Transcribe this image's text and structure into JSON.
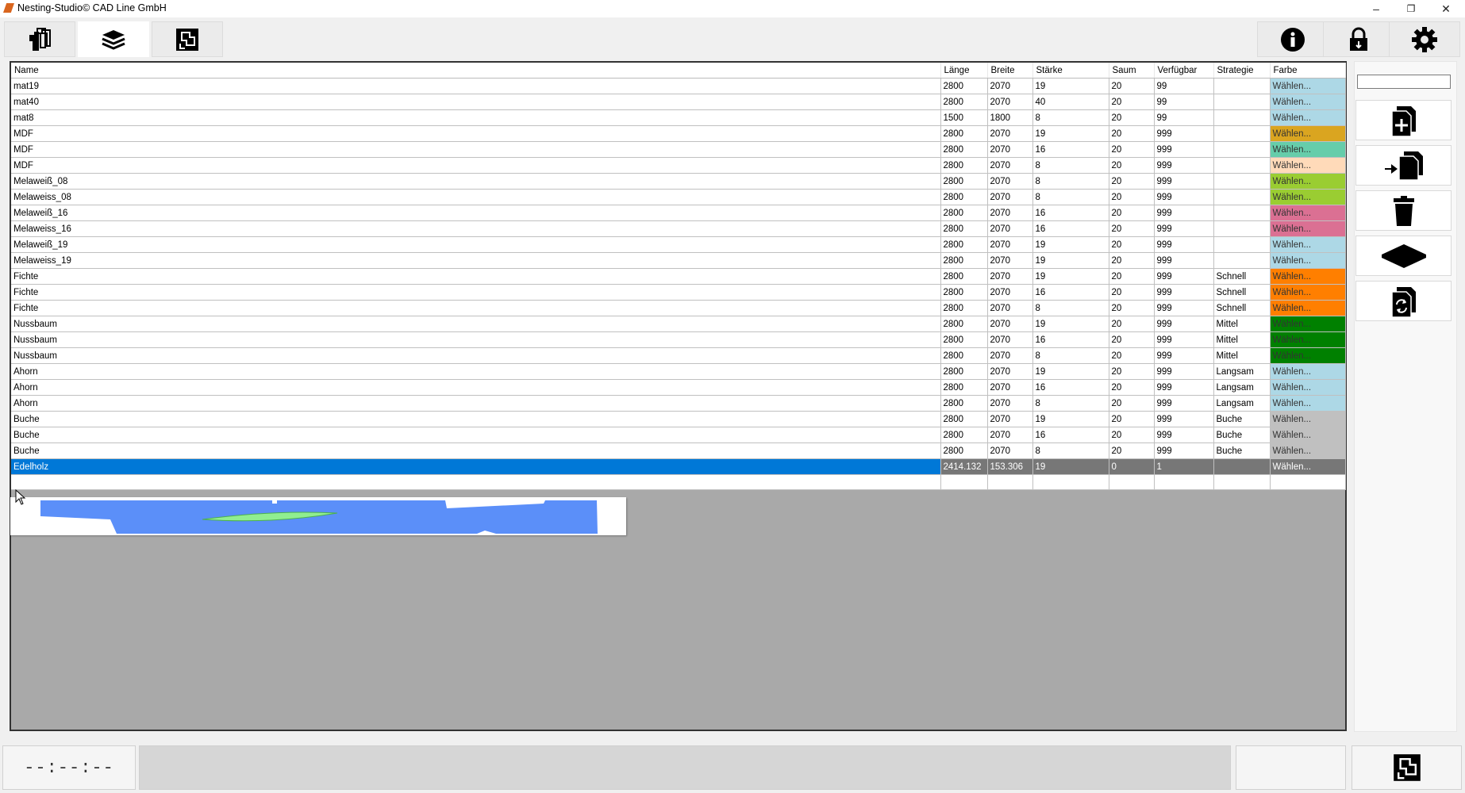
{
  "window": {
    "title": "Nesting-Studio© CAD Line GmbH",
    "minimize": "–",
    "restore": "❐",
    "close": "✕"
  },
  "toolbar": {
    "left_icons": [
      "parts-icon",
      "layers-icon",
      "nesting-icon"
    ],
    "active_tab": "layers-icon",
    "right_icons": [
      "info-icon",
      "lock-icon",
      "gear-icon"
    ]
  },
  "table": {
    "columns": [
      "Name",
      "Länge",
      "Breite",
      "Stärke",
      "Saum",
      "Verfügbar",
      "Strategie",
      "Farbe"
    ],
    "rows": [
      {
        "name": "mat19",
        "laenge": "2800",
        "breite": "2070",
        "staerke": "19",
        "saum": "20",
        "verfuegbar": "99",
        "strategie": "",
        "farbe": "Wählen...",
        "color": "#add8e6"
      },
      {
        "name": "mat40",
        "laenge": "2800",
        "breite": "2070",
        "staerke": "40",
        "saum": "20",
        "verfuegbar": "99",
        "strategie": "",
        "farbe": "Wählen...",
        "color": "#add8e6"
      },
      {
        "name": "mat8",
        "laenge": "1500",
        "breite": "1800",
        "staerke": "8",
        "saum": "20",
        "verfuegbar": "99",
        "strategie": "",
        "farbe": "Wählen...",
        "color": "#add8e6"
      },
      {
        "name": "MDF",
        "laenge": "2800",
        "breite": "2070",
        "staerke": "19",
        "saum": "20",
        "verfuegbar": "999",
        "strategie": "",
        "farbe": "Wählen...",
        "color": "#daa520"
      },
      {
        "name": "MDF",
        "laenge": "2800",
        "breite": "2070",
        "staerke": "16",
        "saum": "20",
        "verfuegbar": "999",
        "strategie": "",
        "farbe": "Wählen...",
        "color": "#66cdaa"
      },
      {
        "name": "MDF",
        "laenge": "2800",
        "breite": "2070",
        "staerke": "8",
        "saum": "20",
        "verfuegbar": "999",
        "strategie": "",
        "farbe": "Wählen...",
        "color": "#ffdab9"
      },
      {
        "name": "Melaweiß_08",
        "laenge": "2800",
        "breite": "2070",
        "staerke": "8",
        "saum": "20",
        "verfuegbar": "999",
        "strategie": "",
        "farbe": "Wählen...",
        "color": "#9acd32"
      },
      {
        "name": "Melaweiss_08",
        "laenge": "2800",
        "breite": "2070",
        "staerke": "8",
        "saum": "20",
        "verfuegbar": "999",
        "strategie": "",
        "farbe": "Wählen...",
        "color": "#9acd32"
      },
      {
        "name": "Melaweiß_16",
        "laenge": "2800",
        "breite": "2070",
        "staerke": "16",
        "saum": "20",
        "verfuegbar": "999",
        "strategie": "",
        "farbe": "Wählen...",
        "color": "#db7093"
      },
      {
        "name": "Melaweiss_16",
        "laenge": "2800",
        "breite": "2070",
        "staerke": "16",
        "saum": "20",
        "verfuegbar": "999",
        "strategie": "",
        "farbe": "Wählen...",
        "color": "#db7093"
      },
      {
        "name": "Melaweiß_19",
        "laenge": "2800",
        "breite": "2070",
        "staerke": "19",
        "saum": "20",
        "verfuegbar": "999",
        "strategie": "",
        "farbe": "Wählen...",
        "color": "#add8e6"
      },
      {
        "name": "Melaweiss_19",
        "laenge": "2800",
        "breite": "2070",
        "staerke": "19",
        "saum": "20",
        "verfuegbar": "999",
        "strategie": "",
        "farbe": "Wählen...",
        "color": "#add8e6"
      },
      {
        "name": "Fichte",
        "laenge": "2800",
        "breite": "2070",
        "staerke": "19",
        "saum": "20",
        "verfuegbar": "999",
        "strategie": "Schnell",
        "farbe": "Wählen...",
        "color": "#ff7f00"
      },
      {
        "name": "Fichte",
        "laenge": "2800",
        "breite": "2070",
        "staerke": "16",
        "saum": "20",
        "verfuegbar": "999",
        "strategie": "Schnell",
        "farbe": "Wählen...",
        "color": "#ff7f00"
      },
      {
        "name": "Fichte",
        "laenge": "2800",
        "breite": "2070",
        "staerke": "8",
        "saum": "20",
        "verfuegbar": "999",
        "strategie": "Schnell",
        "farbe": "Wählen...",
        "color": "#ff7f00"
      },
      {
        "name": "Nussbaum",
        "laenge": "2800",
        "breite": "2070",
        "staerke": "19",
        "saum": "20",
        "verfuegbar": "999",
        "strategie": "Mittel",
        "farbe": "Wählen...",
        "color": "#008000"
      },
      {
        "name": "Nussbaum",
        "laenge": "2800",
        "breite": "2070",
        "staerke": "16",
        "saum": "20",
        "verfuegbar": "999",
        "strategie": "Mittel",
        "farbe": "Wählen...",
        "color": "#008000"
      },
      {
        "name": "Nussbaum",
        "laenge": "2800",
        "breite": "2070",
        "staerke": "8",
        "saum": "20",
        "verfuegbar": "999",
        "strategie": "Mittel",
        "farbe": "Wählen...",
        "color": "#008000"
      },
      {
        "name": "Ahorn",
        "laenge": "2800",
        "breite": "2070",
        "staerke": "19",
        "saum": "20",
        "verfuegbar": "999",
        "strategie": "Langsam",
        "farbe": "Wählen...",
        "color": "#add8e6"
      },
      {
        "name": "Ahorn",
        "laenge": "2800",
        "breite": "2070",
        "staerke": "16",
        "saum": "20",
        "verfuegbar": "999",
        "strategie": "Langsam",
        "farbe": "Wählen...",
        "color": "#add8e6"
      },
      {
        "name": "Ahorn",
        "laenge": "2800",
        "breite": "2070",
        "staerke": "8",
        "saum": "20",
        "verfuegbar": "999",
        "strategie": "Langsam",
        "farbe": "Wählen...",
        "color": "#add8e6"
      },
      {
        "name": "Buche",
        "laenge": "2800",
        "breite": "2070",
        "staerke": "19",
        "saum": "20",
        "verfuegbar": "999",
        "strategie": "Buche",
        "farbe": "Wählen...",
        "color": "#c0c0c0"
      },
      {
        "name": "Buche",
        "laenge": "2800",
        "breite": "2070",
        "staerke": "16",
        "saum": "20",
        "verfuegbar": "999",
        "strategie": "Buche",
        "farbe": "Wählen...",
        "color": "#c0c0c0"
      },
      {
        "name": "Buche",
        "laenge": "2800",
        "breite": "2070",
        "staerke": "8",
        "saum": "20",
        "verfuegbar": "999",
        "strategie": "Buche",
        "farbe": "Wählen...",
        "color": "#c0c0c0"
      },
      {
        "name": "Edelholz",
        "laenge": "2414.132",
        "breite": "153.306",
        "staerke": "19",
        "saum": "0",
        "verfuegbar": "1",
        "strategie": "",
        "farbe": "Wählen...",
        "color": "#777777",
        "selected": true
      }
    ]
  },
  "side_panel": {
    "input_value": "",
    "buttons": [
      "add-document-icon",
      "import-document-icon",
      "trash-icon",
      "sheet-icon",
      "refresh-document-icon"
    ]
  },
  "bottom_bar": {
    "status_text": "--:--:--",
    "right_icon": "nesting-icon"
  },
  "colors": {
    "selection": "#0078d7",
    "table_background": "#a9a9a9",
    "preview_part": "#5b8ff9",
    "preview_highlight": "#90ee90"
  }
}
